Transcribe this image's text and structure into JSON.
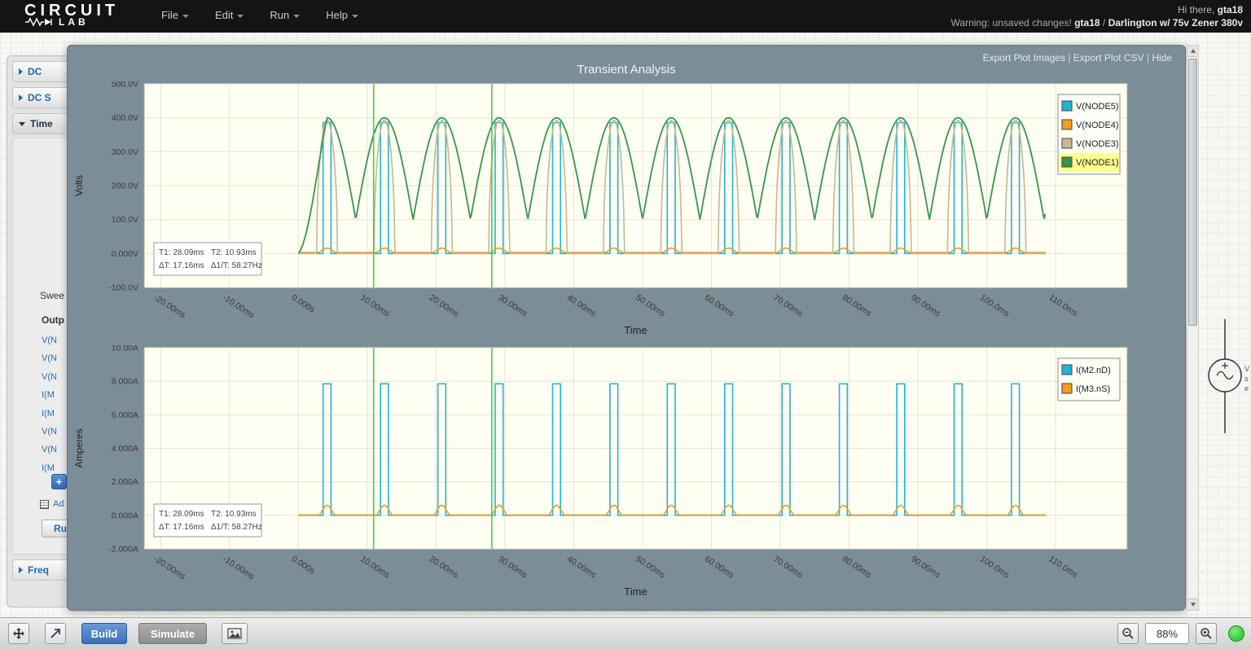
{
  "colors": {
    "panel": "#7b8e98",
    "plot_bg": "#fffef2",
    "plot_frame": "#a8a89a",
    "grid": "#e4e4d5",
    "cursor": "#3ed43e",
    "legend_highlight": "#ffff8e",
    "tick_text": "#3a3a3a",
    "trace_cyan": "#1fb5d8",
    "trace_orange": "#f59b1e",
    "trace_tan": "#c7b794",
    "trace_green": "#35974e"
  },
  "header": {
    "logo": {
      "line1": "CIRCUIT",
      "line2": "LAB"
    },
    "menus": [
      {
        "label": "File"
      },
      {
        "label": "Edit"
      },
      {
        "label": "Run"
      },
      {
        "label": "Help"
      }
    ],
    "greeting": {
      "prefix": "Hi there,",
      "username": "gta18"
    },
    "status": {
      "warning": "Warning: unsaved changes!",
      "user": "gta18",
      "sep": "/",
      "project": "Darlington w/ 75v Zener 380v"
    }
  },
  "sidebar": {
    "sections": [
      {
        "label": "DC"
      },
      {
        "label": "DC S"
      },
      {
        "label": "Time"
      },
      {
        "label": "Freq"
      }
    ],
    "labels": {
      "sweep": "Swee",
      "outputs": "Outp",
      "advanced": "Ad"
    },
    "outputs": [
      "V(N",
      "V(N",
      "V(N",
      "I(M",
      "I(M",
      "V(N",
      "V(N",
      "I(M"
    ],
    "add_button": "+",
    "run_button": "Ru"
  },
  "plot_panel": {
    "title": "Transient Analysis",
    "links": [
      {
        "label": "Export Plot Images"
      },
      {
        "label": "Export Plot CSV"
      },
      {
        "label": "Hide"
      }
    ],
    "link_sep": "|"
  },
  "chart_data": [
    {
      "type": "line",
      "title": "Transient Analysis",
      "xlabel": "Time",
      "ylabel": "Volts",
      "xlim_ms": [
        -22.4,
        120.4
      ],
      "ylim": [
        -100,
        500
      ],
      "x_ticks": [
        {
          "v": -20,
          "label": "-20.00ms"
        },
        {
          "v": -10,
          "label": "-10.00ms"
        },
        {
          "v": 0,
          "label": "0.000s"
        },
        {
          "v": 10,
          "label": "10.00ms"
        },
        {
          "v": 20,
          "label": "20.00ms"
        },
        {
          "v": 30,
          "label": "30.00ms"
        },
        {
          "v": 40,
          "label": "40.00ms"
        },
        {
          "v": 50,
          "label": "50.00ms"
        },
        {
          "v": 60,
          "label": "60.00ms"
        },
        {
          "v": 70,
          "label": "70.00ms"
        },
        {
          "v": 80,
          "label": "80.00ms"
        },
        {
          "v": 90,
          "label": "90.00ms"
        },
        {
          "v": 100,
          "label": "100.0ms"
        },
        {
          "v": 110,
          "label": "110.0ms"
        }
      ],
      "y_ticks": [
        {
          "v": 500,
          "label": "500.0V"
        },
        {
          "v": 400,
          "label": "400.0V"
        },
        {
          "v": 300,
          "label": "300.0V"
        },
        {
          "v": 200,
          "label": "200.0V"
        },
        {
          "v": 100,
          "label": "100.0V"
        },
        {
          "v": 0,
          "label": "0.000V"
        },
        {
          "v": -100,
          "label": "-100.0V"
        }
      ],
      "t_start_ms": 0,
      "t_end_ms": 108.6,
      "period_ms": 8.333,
      "first_peak_ms": 4.17,
      "series": [
        {
          "name": "V(NODE5)",
          "color": "#1fb5d8",
          "shape": "rect_pulse",
          "high": 386,
          "low": 0,
          "width_ms": 1.15
        },
        {
          "name": "V(NODE4)",
          "color": "#f59b1e",
          "shape": "bump",
          "base": 3,
          "peak": 16,
          "width_ms": 2.6
        },
        {
          "name": "V(NODE3)",
          "color": "#c7b794",
          "shape": "bell",
          "base": 0,
          "peak": 393,
          "width_ms": 3.0
        },
        {
          "name": "V(NODE1)",
          "color": "#35974e",
          "shape": "rectified_sine",
          "min": 100,
          "max": 400,
          "legend_highlight": true
        }
      ],
      "cursors": {
        "x1_ms": 10.93,
        "x2_ms": 28.09,
        "readout": {
          "t1": "T1: 28.09ms",
          "t2": "T2: 10.93ms",
          "dt": "ΔT: 17.16ms",
          "freq": "Δ1/T: 58.27Hz"
        }
      }
    },
    {
      "type": "line",
      "title": "",
      "xlabel": "Time",
      "ylabel": "Amperes",
      "xlim_ms": [
        -22.4,
        120.4
      ],
      "ylim": [
        -2,
        10
      ],
      "x_ticks": [
        {
          "v": -20,
          "label": "-20.00ms"
        },
        {
          "v": -10,
          "label": "-10.00ms"
        },
        {
          "v": 0,
          "label": "0.000s"
        },
        {
          "v": 10,
          "label": "10.00ms"
        },
        {
          "v": 20,
          "label": "20.00ms"
        },
        {
          "v": 30,
          "label": "30.00ms"
        },
        {
          "v": 40,
          "label": "40.00ms"
        },
        {
          "v": 50,
          "label": "50.00ms"
        },
        {
          "v": 60,
          "label": "60.00ms"
        },
        {
          "v": 70,
          "label": "70.00ms"
        },
        {
          "v": 80,
          "label": "80.00ms"
        },
        {
          "v": 90,
          "label": "90.00ms"
        },
        {
          "v": 100,
          "label": "100.0ms"
        },
        {
          "v": 110,
          "label": "110.0ms"
        }
      ],
      "y_ticks": [
        {
          "v": 10,
          "label": "10.00A"
        },
        {
          "v": 8,
          "label": "8.000A"
        },
        {
          "v": 6,
          "label": "6.000A"
        },
        {
          "v": 4,
          "label": "4.000A"
        },
        {
          "v": 2,
          "label": "2.000A"
        },
        {
          "v": 0,
          "label": "0.000A"
        },
        {
          "v": -2,
          "label": "-2.000A"
        }
      ],
      "t_start_ms": 0,
      "t_end_ms": 108.6,
      "period_ms": 8.333,
      "first_peak_ms": 4.17,
      "series": [
        {
          "name": "I(M2.nD)",
          "color": "#1fb5d8",
          "shape": "rect_pulse",
          "high": 7.85,
          "low": 0,
          "width_ms": 1.15
        },
        {
          "name": "I(M3.nS)",
          "color": "#f59b1e",
          "shape": "bump",
          "base": 0.02,
          "peak": 0.6,
          "width_ms": 2.4
        }
      ],
      "cursors": {
        "x1_ms": 10.93,
        "x2_ms": 28.09,
        "readout": {
          "t1": "T1: 28.09ms",
          "t2": "T2: 10.93ms",
          "dt": "ΔT: 17.16ms",
          "freq": "Δ1/T: 58.27Hz"
        }
      }
    }
  ],
  "toolbar": {
    "build": "Build",
    "simulate": "Simulate",
    "zoom_level": "88%"
  },
  "schematic": {
    "labels": [
      "V",
      "s",
      "e"
    ]
  }
}
